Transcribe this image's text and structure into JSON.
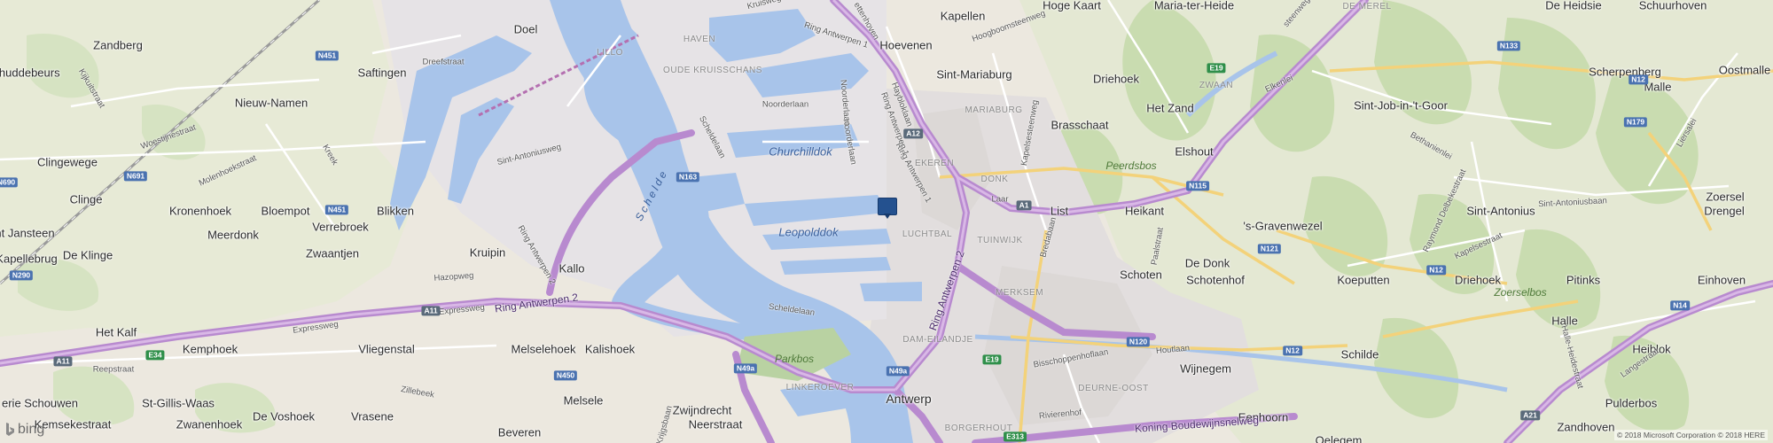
{
  "map": {
    "places": [
      {
        "id": "doel",
        "name": "Doel"
      },
      {
        "id": "zandberg",
        "name": "Zandberg"
      },
      {
        "id": "schuddebeurs",
        "name": "chuddebeurs"
      },
      {
        "id": "saftingen",
        "name": "Saftingen"
      },
      {
        "id": "nieuw-namen",
        "name": "Nieuw-Namen"
      },
      {
        "id": "clingewege",
        "name": "Clingewege"
      },
      {
        "id": "clinge",
        "name": "Clinge"
      },
      {
        "id": "kronenhoek",
        "name": "Kronenhoek"
      },
      {
        "id": "bloempot",
        "name": "Bloempot"
      },
      {
        "id": "blikken",
        "name": "Blikken"
      },
      {
        "id": "nt-janssteen",
        "name": "nt Jansteen"
      },
      {
        "id": "meerdonk",
        "name": "Meerdonk"
      },
      {
        "id": "verrebroek",
        "name": "Verrebroek"
      },
      {
        "id": "kruipin",
        "name": "Kruipin"
      },
      {
        "id": "kapellebrug",
        "name": "Kapellebrug"
      },
      {
        "id": "de-klinge",
        "name": "De Klinge"
      },
      {
        "id": "zwaantjen",
        "name": "Zwaantjen"
      },
      {
        "id": "kallo",
        "name": "Kallo"
      },
      {
        "id": "het-kalf",
        "name": "Het Kalf"
      },
      {
        "id": "kemphoek",
        "name": "Kemphoek"
      },
      {
        "id": "vliegenstal",
        "name": "Vliegenstal"
      },
      {
        "id": "melselehoek",
        "name": "Melselehoek"
      },
      {
        "id": "kalishoek",
        "name": "Kalishoek"
      },
      {
        "id": "st-gillis-waas",
        "name": "St-Gillis-Waas"
      },
      {
        "id": "de-voshoek",
        "name": "De Voshoek"
      },
      {
        "id": "vrasene",
        "name": "Vrasene"
      },
      {
        "id": "melsele",
        "name": "Melsele"
      },
      {
        "id": "zwijndrecht",
        "name": "Zwijndrecht"
      },
      {
        "id": "neerstraat",
        "name": "Neerstraat"
      },
      {
        "id": "beveren",
        "name": "Beveren"
      },
      {
        "id": "erie-schouwen",
        "name": "erie Schouwen"
      },
      {
        "id": "kemsekestraat",
        "name": "Kemsekestraat"
      },
      {
        "id": "zwanenhoek",
        "name": "Zwanenhoek"
      },
      {
        "id": "antwerp",
        "name": "Antwerp"
      },
      {
        "id": "hoevenen",
        "name": "Hoevenen"
      },
      {
        "id": "kapellen",
        "name": "Kapellen"
      },
      {
        "id": "hoge-kaart",
        "name": "Hoge Kaart"
      },
      {
        "id": "maria-ter-heide",
        "name": "Maria-ter-Heide"
      },
      {
        "id": "sint-mariaburg",
        "name": "Sint-Mariaburg"
      },
      {
        "id": "driehoek-1",
        "name": "Driehoek"
      },
      {
        "id": "brasschaat",
        "name": "Brasschaat"
      },
      {
        "id": "het-zand",
        "name": "Het Zand"
      },
      {
        "id": "elshout",
        "name": "Elshout"
      },
      {
        "id": "list",
        "name": "List"
      },
      {
        "id": "heikant",
        "name": "Heikant"
      },
      {
        "id": "s-gravenwezel",
        "name": "'s-Gravenwezel"
      },
      {
        "id": "schoten",
        "name": "Schoten"
      },
      {
        "id": "de-donk",
        "name": "De Donk"
      },
      {
        "id": "schotenhof",
        "name": "Schotenhof"
      },
      {
        "id": "koeputten",
        "name": "Koeputten"
      },
      {
        "id": "wijnegem",
        "name": "Wijnegem"
      },
      {
        "id": "schilde",
        "name": "Schilde"
      },
      {
        "id": "eenhoorn",
        "name": "Eenhoorn"
      },
      {
        "id": "oelegem",
        "name": "Oelegem"
      },
      {
        "id": "de-heidsie",
        "name": "De Heidsie"
      },
      {
        "id": "schuurhoven",
        "name": "Schuurhoven"
      },
      {
        "id": "scherpenberg",
        "name": "Scherpenberg"
      },
      {
        "id": "malle",
        "name": "Malle"
      },
      {
        "id": "oostmalle",
        "name": "Oostmalle"
      },
      {
        "id": "sint-job",
        "name": "Sint-Job-in-'t-Goor"
      },
      {
        "id": "sint-antonius",
        "name": "Sint-Antonius"
      },
      {
        "id": "zoersel",
        "name": "Zoersel"
      },
      {
        "id": "drengel",
        "name": "Drengel"
      },
      {
        "id": "driehoek-2",
        "name": "Driehoek"
      },
      {
        "id": "pitinks",
        "name": "Pitinks"
      },
      {
        "id": "einhoven",
        "name": "Einhoven"
      },
      {
        "id": "halle",
        "name": "Halle"
      },
      {
        "id": "heiblok",
        "name": "Heiblok"
      },
      {
        "id": "pulderbos",
        "name": "Pulderbos"
      },
      {
        "id": "zandhoven",
        "name": "Zandhoven"
      }
    ],
    "districts": [
      {
        "id": "lillo",
        "name": "LILLO"
      },
      {
        "id": "haven",
        "name": "HAVEN"
      },
      {
        "id": "oude-kruisschans",
        "name": "OUDE KRUISSCHANS"
      },
      {
        "id": "mariaburg",
        "name": "MARIABURG"
      },
      {
        "id": "ekeren",
        "name": "EKEREN"
      },
      {
        "id": "donk",
        "name": "DONK"
      },
      {
        "id": "luchtbal",
        "name": "LUCHTBAL"
      },
      {
        "id": "tuinwijk",
        "name": "TUINWIJK"
      },
      {
        "id": "merksem",
        "name": "MERKSEM"
      },
      {
        "id": "dam-eilandje",
        "name": "DAM-EILANDJE"
      },
      {
        "id": "linkeroever",
        "name": "LINKEROEVER"
      },
      {
        "id": "deurne-oost",
        "name": "DEURNE-OOST"
      },
      {
        "id": "borgerhout",
        "name": "BORGERHOUT"
      },
      {
        "id": "de-merel",
        "name": "DE MEREL"
      },
      {
        "id": "zwaan",
        "name": "ZWAAN"
      }
    ],
    "water": [
      {
        "id": "churchilldok",
        "name": "Churchilldok"
      },
      {
        "id": "leopolddok",
        "name": "Leopolddok"
      },
      {
        "id": "schelde",
        "name": "Schelde"
      }
    ],
    "forests": [
      {
        "id": "peerdsbos",
        "name": "Peerdsbos"
      },
      {
        "id": "parkbos",
        "name": "Parkbos"
      },
      {
        "id": "zoerselbos",
        "name": "Zoerselbos"
      }
    ],
    "roads": [
      {
        "id": "ring-antwerpen-2-main",
        "name": "Ring Antwerpen 2"
      },
      {
        "id": "ring-antwerpen-2-east",
        "name": "Ring Antwerpen 2"
      },
      {
        "id": "ring-antwerpen-2-kallo",
        "name": "Ring Antwerpen 2"
      },
      {
        "id": "ring-antwerpen-1-top",
        "name": "Ring Antwerpen 1"
      },
      {
        "id": "ring-antwerpen-1-mid",
        "name": "Ring Antwerpen 1"
      },
      {
        "id": "ring-antwerpen-1-ne",
        "name": "Ring Antwerpen 1"
      },
      {
        "id": "expressweg",
        "name": "Expressweg"
      },
      {
        "id": "expressweg-2",
        "name": "Expressweg"
      },
      {
        "id": "koning-boudewijn",
        "name": "Koning Boudewijnsnelweg"
      },
      {
        "id": "scheldelaan-1",
        "name": "Scheldelaan"
      },
      {
        "id": "scheldelaan-2",
        "name": "Scheldelaan"
      },
      {
        "id": "noorderlaan-1",
        "name": "Noorderlaan"
      },
      {
        "id": "noorderlaan-2",
        "name": "Noorderlaan"
      },
      {
        "id": "sint-antoniusweg",
        "name": "Sint-Antoniusweg"
      },
      {
        "id": "hazopweg",
        "name": "Hazopweg"
      },
      {
        "id": "woestijnestraat",
        "name": "Woestijnestraat"
      },
      {
        "id": "molenhoekstraat",
        "name": "Molenhoekstraat"
      },
      {
        "id": "kijkuitstraat",
        "name": "Kijkuitstraat"
      },
      {
        "id": "dreefstraat",
        "name": "Dreefstraat"
      },
      {
        "id": "kreek",
        "name": "Kreek"
      },
      {
        "id": "reepstraat",
        "name": "Reepstraat"
      },
      {
        "id": "zillebeek",
        "name": "Zillebeek"
      },
      {
        "id": "krijgsbaan",
        "name": "Krijgsbaan"
      },
      {
        "id": "bisschoppenhoflaan",
        "name": "Bisschoppenhoflaan"
      },
      {
        "id": "houtlaan",
        "name": "Houtlaan"
      },
      {
        "id": "rivierenhof",
        "name": "Rivierenhof"
      },
      {
        "id": "bredabaan",
        "name": "Bredabaan"
      },
      {
        "id": "kapelsesteenweg",
        "name": "Kapelsesteenweg"
      },
      {
        "id": "hoogboomsteenweg",
        "name": "Hoogboomsteenweg"
      },
      {
        "id": "elkenlei",
        "name": "Elkenlei"
      },
      {
        "id": "laar",
        "name": "Laar"
      },
      {
        "id": "paalstraat",
        "name": "Paalstraat"
      },
      {
        "id": "bethanienlei",
        "name": "Bethanienlei"
      },
      {
        "id": "kapelsestraat",
        "name": "Kapelsestraat"
      },
      {
        "id": "raymond-delbekestraat",
        "name": "Raymond Delbekestraat"
      },
      {
        "id": "liersalei",
        "name": "Liersalei"
      },
      {
        "id": "langestraat",
        "name": "Langestraat"
      },
      {
        "id": "haybloklaan",
        "name": "Haybloklaan"
      },
      {
        "id": "steenweg",
        "name": "steenweg"
      },
      {
        "id": "sint-antoniusbaan",
        "name": "Sint-Antoniusbaan"
      },
      {
        "id": "halle-heidestraat",
        "name": "Halle-Heidestraat"
      },
      {
        "id": "kruisweg",
        "name": "Kruisweg"
      },
      {
        "id": "ettenhoven",
        "name": "ettenhoven"
      },
      {
        "id": "noorderlaan-3",
        "name": "Noorderlaan"
      }
    ],
    "shields": [
      {
        "id": "n451-top",
        "name": "N451"
      },
      {
        "id": "n451-mid",
        "name": "N451"
      },
      {
        "id": "n691",
        "name": "N691"
      },
      {
        "id": "n690",
        "name": "N690"
      },
      {
        "id": "n290",
        "name": "N290"
      },
      {
        "id": "n163",
        "name": "N163"
      },
      {
        "id": "a11-left",
        "name": "A11"
      },
      {
        "id": "a11-mid",
        "name": "A11"
      },
      {
        "id": "e34",
        "name": "E34"
      },
      {
        "id": "n450",
        "name": "N450"
      },
      {
        "id": "n49a-1",
        "name": "N49a"
      },
      {
        "id": "n49a-2",
        "name": "N49a"
      },
      {
        "id": "a12",
        "name": "A12"
      },
      {
        "id": "a1",
        "name": "A1"
      },
      {
        "id": "e19-1",
        "name": "E19"
      },
      {
        "id": "e19-2",
        "name": "E19"
      },
      {
        "id": "n115",
        "name": "N115"
      },
      {
        "id": "n121",
        "name": "N121"
      },
      {
        "id": "n120",
        "name": "N120"
      },
      {
        "id": "n12-1",
        "name": "N12"
      },
      {
        "id": "n12-2",
        "name": "N12"
      },
      {
        "id": "n12-3",
        "name": "N12"
      },
      {
        "id": "n133",
        "name": "N133"
      },
      {
        "id": "n179",
        "name": "N179"
      },
      {
        "id": "n14",
        "name": "N14"
      },
      {
        "id": "a21",
        "name": "A21"
      },
      {
        "id": "e313",
        "name": "E313"
      }
    ],
    "pin": {
      "label": "Location marker"
    },
    "brand": "bing",
    "copyright": "© 2018 Microsoft Corporation © 2018 HERE"
  }
}
